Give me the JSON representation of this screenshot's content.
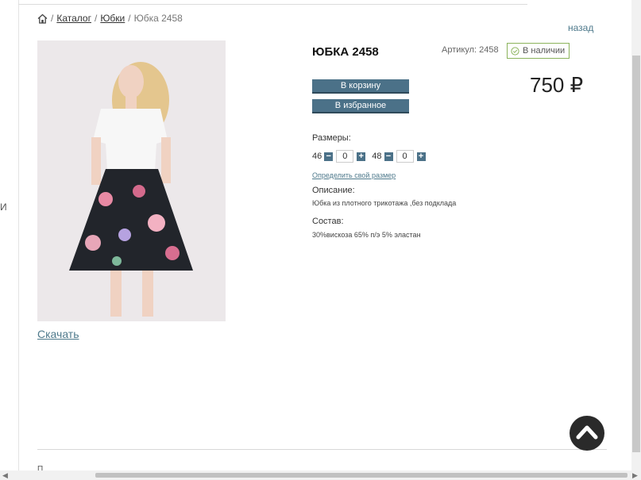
{
  "breadcrumb": {
    "catalog": "Каталог",
    "category": "Юбки",
    "current": "Юбка 2458",
    "sep": "/"
  },
  "back_link": "назад",
  "download_link": "Скачать",
  "product": {
    "title": "ЮБКА 2458",
    "sku": "Артикул: 2458",
    "stock": "В наличии",
    "price": "750 ₽",
    "cart_button": "В корзину",
    "fav_button": "В избранное"
  },
  "sizes": {
    "label": "Размеры:",
    "items": [
      {
        "size": "46",
        "qty": "0"
      },
      {
        "size": "48",
        "qty": "0"
      }
    ],
    "link": "Определить свой размер"
  },
  "description": {
    "label": "Описание:",
    "text": "Юбка из плотного трикотажа ,без подклада"
  },
  "composition": {
    "label": "Состав:",
    "text": "30%вискоза 65% п/э 5% эластан"
  },
  "left_glyph": "И",
  "bottom_glyph": "П",
  "colors": {
    "accent": "#4b7188",
    "link": "#4f7a8c",
    "stock_border": "#8bb35b"
  }
}
